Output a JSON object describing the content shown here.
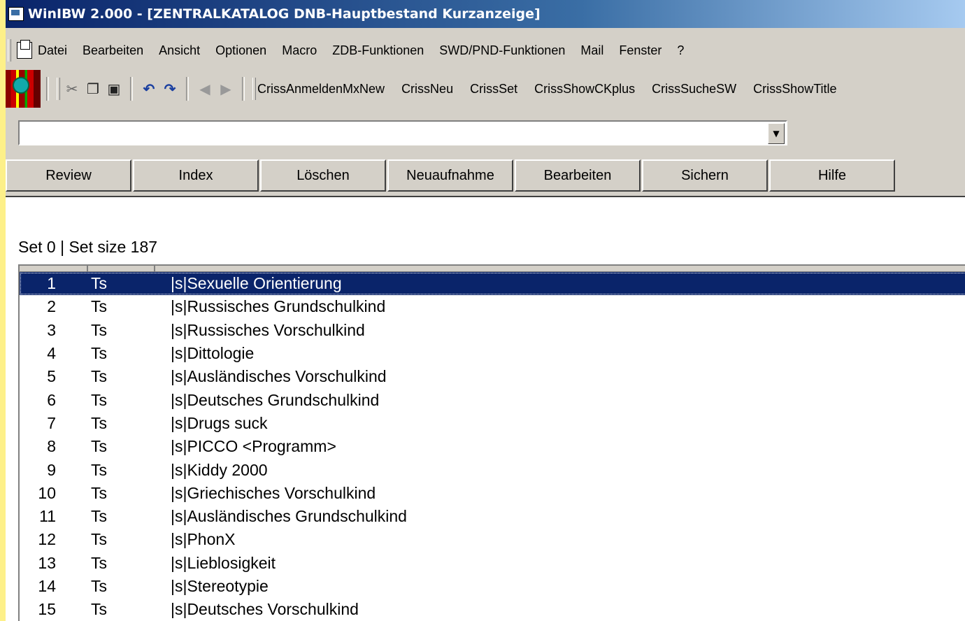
{
  "window": {
    "title": "WinIBW 2.000 - [ZENTRALKATALOG DNB-Hauptbestand Kurzanzeige]"
  },
  "menubar": {
    "items": [
      {
        "label": "Datei"
      },
      {
        "label": "Bearbeiten"
      },
      {
        "label": "Ansicht"
      },
      {
        "label": "Optionen"
      },
      {
        "label": "Macro"
      },
      {
        "label": "ZDB-Funktionen"
      },
      {
        "label": "SWD/PND-Funktionen"
      },
      {
        "label": "Mail"
      },
      {
        "label": "Fenster"
      },
      {
        "label": "?"
      }
    ]
  },
  "toolbar": {
    "icons": [
      "cut-icon",
      "copy-icon",
      "paste-icon",
      "undo-icon",
      "redo-icon",
      "back-icon",
      "forward-icon"
    ],
    "macros": [
      {
        "label": "CrissAnmeldenMxNew"
      },
      {
        "label": "CrissNeu"
      },
      {
        "label": "CrissSet"
      },
      {
        "label": "CrissShowCKplus"
      },
      {
        "label": "CrissSucheSW"
      },
      {
        "label": "CrissShowTitle"
      }
    ]
  },
  "command": {
    "value": ""
  },
  "buttons": [
    {
      "label": "Review"
    },
    {
      "label": "Index"
    },
    {
      "label": "Löschen"
    },
    {
      "label": "Neuaufnahme"
    },
    {
      "label": "Bearbeiten"
    },
    {
      "label": "Sichern"
    },
    {
      "label": "Hilfe"
    }
  ],
  "content": {
    "set_info": "Set 0 |  Set size 187",
    "rows": [
      {
        "num": "1",
        "type": "Ts",
        "text": "|s|Sexuelle Orientierung",
        "selected": true
      },
      {
        "num": "2",
        "type": "Ts",
        "text": "|s|Russisches Grundschulkind"
      },
      {
        "num": "3",
        "type": "Ts",
        "text": "|s|Russisches Vorschulkind"
      },
      {
        "num": "4",
        "type": "Ts",
        "text": "|s|Dittologie"
      },
      {
        "num": "5",
        "type": "Ts",
        "text": "|s|Ausländisches Vorschulkind"
      },
      {
        "num": "6",
        "type": "Ts",
        "text": "|s|Deutsches Grundschulkind"
      },
      {
        "num": "7",
        "type": "Ts",
        "text": "|s|Drugs suck"
      },
      {
        "num": "8",
        "type": "Ts",
        "text": "|s|PICCO <Programm>"
      },
      {
        "num": "9",
        "type": "Ts",
        "text": "|s|Kiddy 2000"
      },
      {
        "num": "10",
        "type": "Ts",
        "text": "|s|Griechisches Vorschulkind"
      },
      {
        "num": "11",
        "type": "Ts",
        "text": "|s|Ausländisches Grundschulkind"
      },
      {
        "num": "12",
        "type": "Ts",
        "text": "|s|PhonX"
      },
      {
        "num": "13",
        "type": "Ts",
        "text": "|s|Lieblosigkeit"
      },
      {
        "num": "14",
        "type": "Ts",
        "text": "|s|Stereotypie"
      },
      {
        "num": "15",
        "type": "Ts",
        "text": "|s|Deutsches Vorschulkind"
      }
    ]
  }
}
